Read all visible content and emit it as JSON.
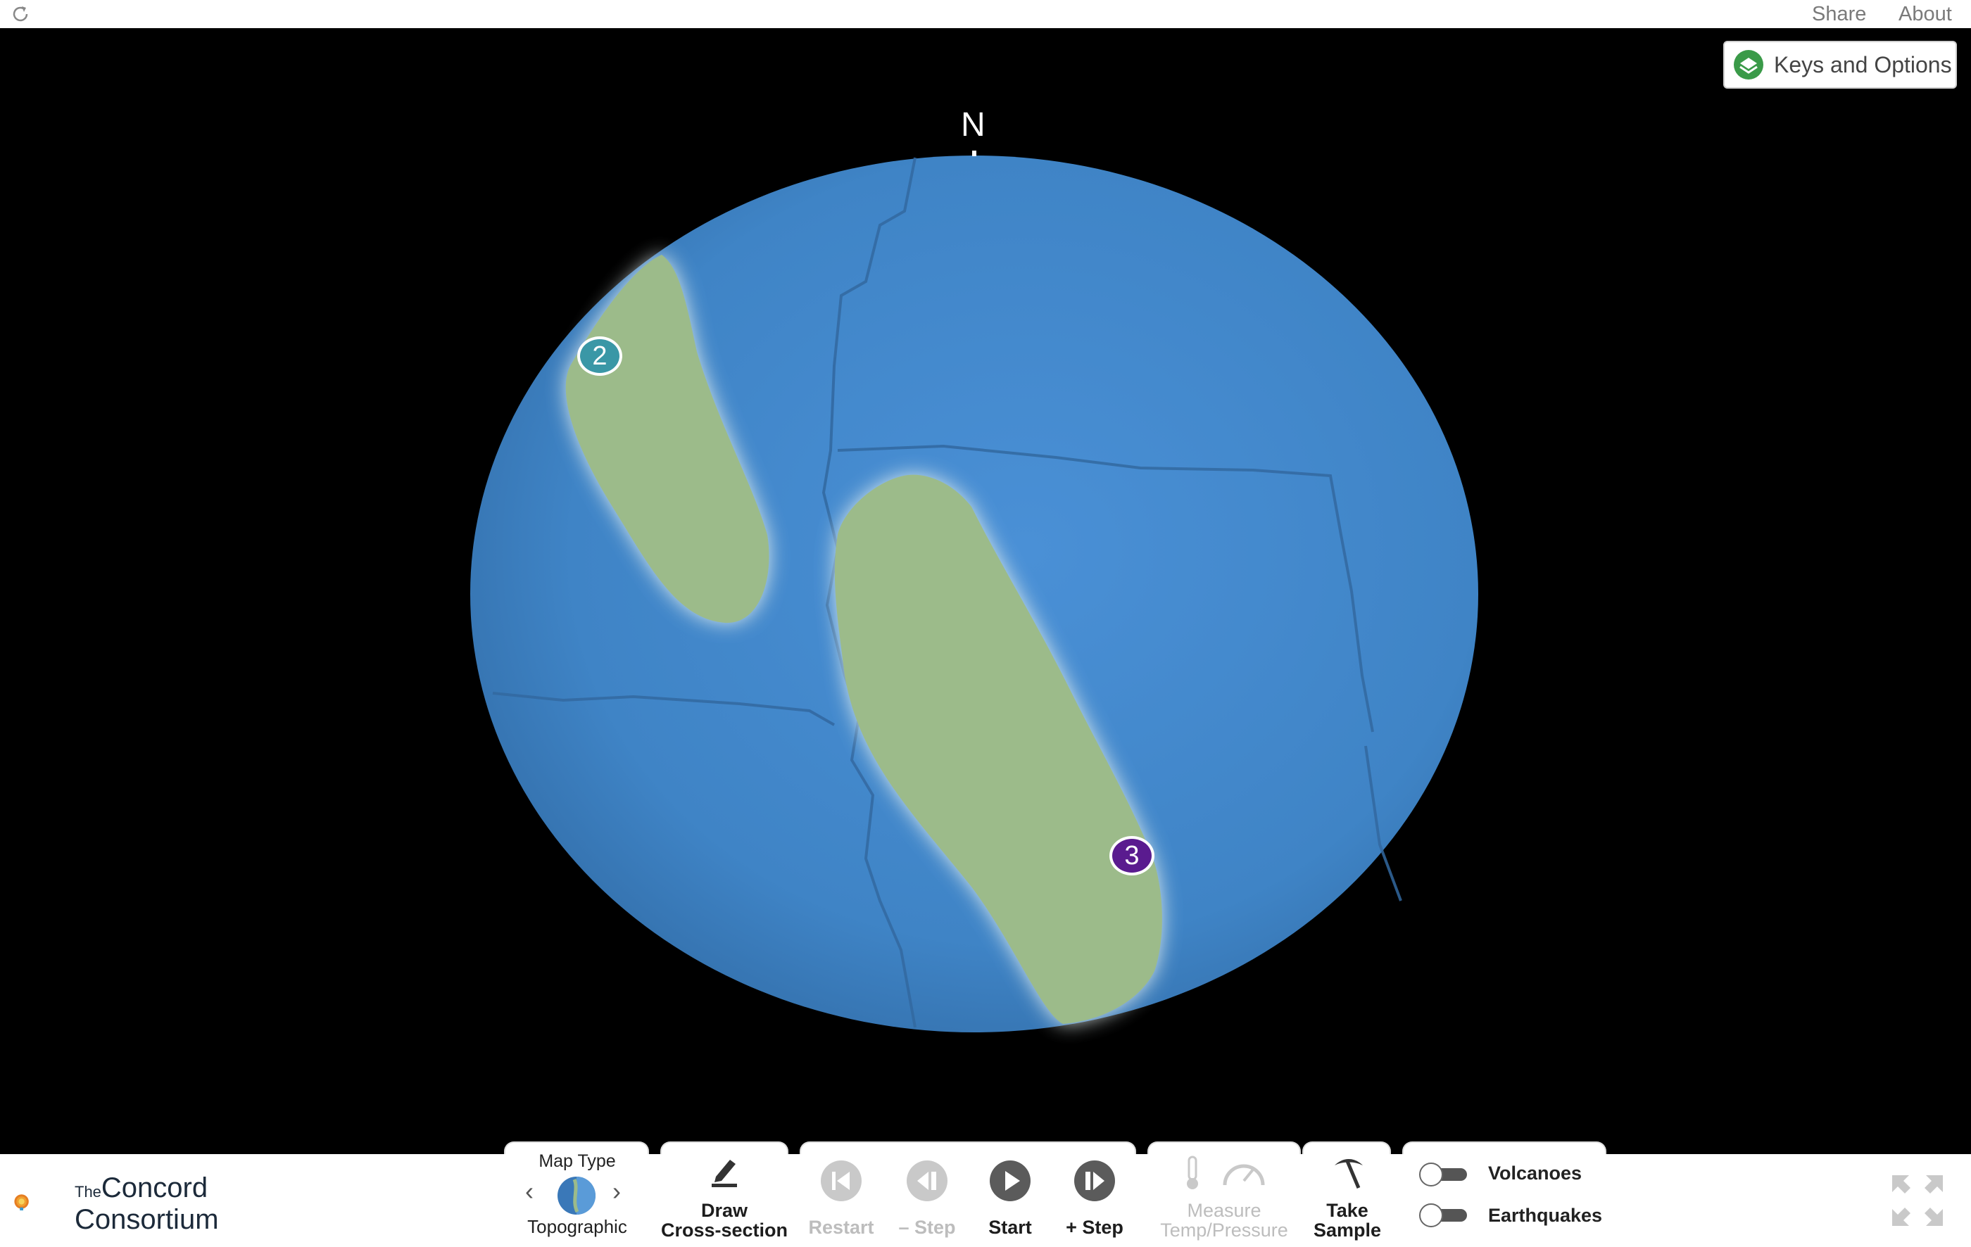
{
  "topbar": {
    "share_label": "Share",
    "about_label": "About",
    "reload_icon": "reload-icon"
  },
  "stage": {
    "keys_button_label": "Keys and Options",
    "north_label": "N",
    "markers": [
      {
        "label": "2",
        "color": "#3a97a6"
      },
      {
        "label": "3",
        "color": "#5a1b8f"
      }
    ],
    "colors": {
      "ocean": "#4a8fd0",
      "continent": "#9cbb8a",
      "background": "#000000"
    }
  },
  "logo": {
    "the": "The",
    "line1": "Concord",
    "line2": "Consortium"
  },
  "controls": {
    "map_type_title": "Map Type",
    "map_type_value": "Topographic",
    "draw_line1": "Draw",
    "draw_line2": "Cross-section",
    "restart_label": "Restart",
    "step_back_label": "– Step",
    "start_label": "Start",
    "step_fwd_label": "+ Step",
    "measure_line1": "Measure",
    "measure_line2": "Temp/Pressure",
    "sample_line1": "Take",
    "sample_line2": "Sample",
    "volcanoes_label": "Volcanoes",
    "earthquakes_label": "Earthquakes",
    "volcanoes_on": false,
    "earthquakes_on": false
  }
}
